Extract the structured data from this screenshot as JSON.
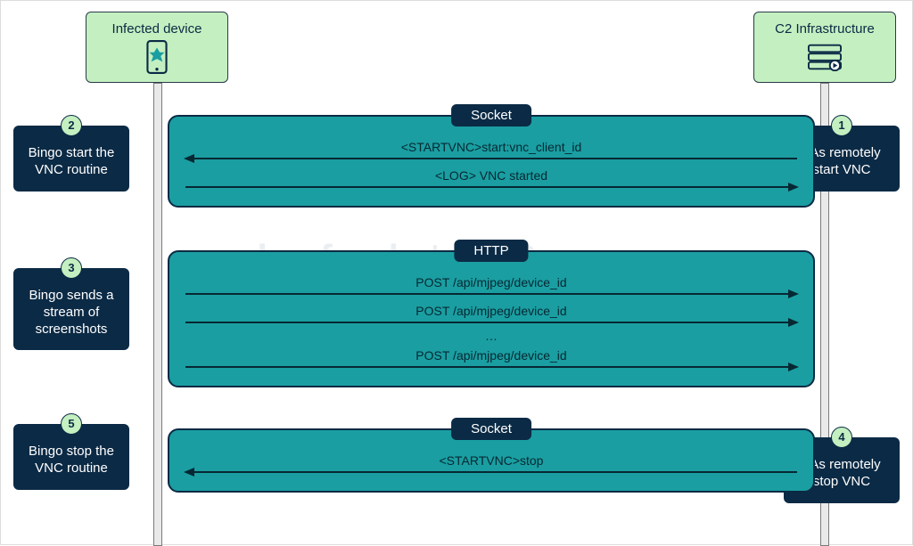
{
  "participants": {
    "left": {
      "label": "Infected device"
    },
    "right": {
      "label": "C2 Infrastructure"
    }
  },
  "steps": {
    "s1": {
      "num": "1",
      "text": "TAs remotely start VNC"
    },
    "s2": {
      "num": "2",
      "text": "Bingo start the VNC routine"
    },
    "s3": {
      "num": "3",
      "text": "Bingo sends a stream of screenshots"
    },
    "s4": {
      "num": "4",
      "text": "TAs remotely stop VNC"
    },
    "s5": {
      "num": "5",
      "text": "Bingo stop the VNC routine"
    }
  },
  "blocks": {
    "b1": {
      "title": "Socket",
      "messages": [
        {
          "dir": "left",
          "text": "<STARTVNC>start:vnc_client_id"
        },
        {
          "dir": "right",
          "text": "<LOG> VNC started"
        }
      ]
    },
    "b2": {
      "title": "HTTP",
      "messages": [
        {
          "dir": "right",
          "text": "POST /api/mjpeg/device_id"
        },
        {
          "dir": "right",
          "text": "POST /api/mjpeg/device_id"
        },
        {
          "dir": "right",
          "text": "POST /api/mjpeg/device_id"
        }
      ],
      "ellipsis": "…"
    },
    "b3": {
      "title": "Socket",
      "messages": [
        {
          "dir": "left",
          "text": "<STARTVNC>stop"
        }
      ]
    }
  },
  "watermark": {
    "brand": "cleafy",
    "suffix": "LABS"
  }
}
